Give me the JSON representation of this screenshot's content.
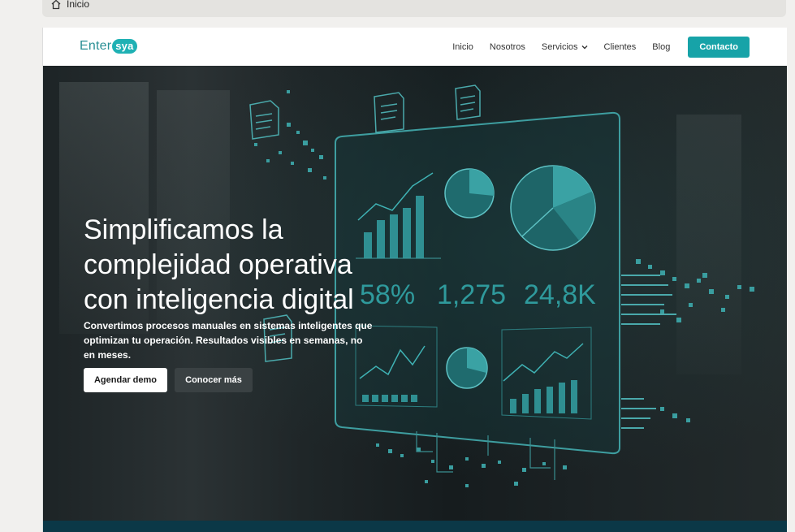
{
  "breadcrumb": {
    "label": "Inicio"
  },
  "brand": {
    "name_prefix": "Enter",
    "name_badge": "sya"
  },
  "nav": {
    "items": [
      {
        "label": "Inicio"
      },
      {
        "label": "Nosotros"
      },
      {
        "label": "Servicios"
      },
      {
        "label": "Clientes"
      },
      {
        "label": "Blog"
      }
    ],
    "cta_label": "Contacto"
  },
  "hero": {
    "title": "Simplificamos la complejidad operativa con inteligencia digital",
    "subtitle": "Convertimos procesos manuales en sistemas inteligentes que optimizan tu operación. Resultados visibles en semanas, no en meses.",
    "primary_button": "Agendar demo",
    "secondary_button": "Conocer más"
  },
  "dashboard_stats": {
    "stat1": "58%",
    "stat2": "1,275",
    "stat3": "24,8K"
  },
  "colors": {
    "accent": "#17a3a8",
    "dark_band": "#0b3847",
    "hero_bg": "#1b2224"
  }
}
